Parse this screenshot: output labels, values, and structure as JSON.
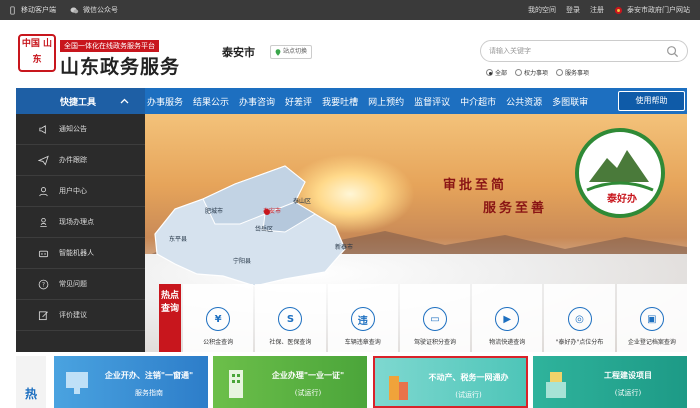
{
  "topbar": {
    "left": [
      "移动客户端",
      "微信公众号"
    ],
    "right": [
      "我的空间",
      "登录",
      "注册",
      "泰安市政府门户网站"
    ]
  },
  "header": {
    "logo_text": "中国 山东",
    "slogan": "全国一体化在线政务服务平台",
    "site_name": "山东政务服务",
    "city": "泰安市",
    "switch_label": "站点切换",
    "search_placeholder": "请输入关键字",
    "filters": [
      "全部",
      "权力事项",
      "服务事项"
    ],
    "filter_selected": "全部"
  },
  "nav": {
    "tool_label": "快捷工具",
    "items": [
      "办事服务",
      "结果公示",
      "办事咨询",
      "好差评",
      "我要吐槽",
      "网上预约",
      "监督评议",
      "中介超市",
      "公共资源",
      "多图联审"
    ],
    "help": "使用帮助"
  },
  "sidebar": {
    "items": [
      {
        "label": "通知公告",
        "icon": "megaphone-icon"
      },
      {
        "label": "办件跟踪",
        "icon": "paper-plane-icon"
      },
      {
        "label": "用户中心",
        "icon": "user-icon"
      },
      {
        "label": "现场办理点",
        "icon": "person-pin-icon"
      },
      {
        "label": "智能机器人",
        "icon": "robot-icon"
      },
      {
        "label": "常见问题",
        "icon": "question-icon"
      },
      {
        "label": "评价建议",
        "icon": "edit-icon"
      }
    ]
  },
  "banner": {
    "slogan_line1": "审批至简",
    "slogan_line2": "服务至善",
    "emblem_text": "泰好办",
    "map_labels": [
      "肥城市",
      "泰安市",
      "泰山区",
      "岱岳区",
      "东平县",
      "宁阳县",
      "新泰市"
    ]
  },
  "hot_label": "热点查询",
  "hot_tiles": [
    {
      "label": "公积金查询",
      "glyph": "¥",
      "icon": "yuan-icon"
    },
    {
      "label": "社保、医保查询",
      "glyph": "S",
      "icon": "shield-icon"
    },
    {
      "label": "车辆违章查询",
      "glyph": "违",
      "icon": "violation-icon"
    },
    {
      "label": "驾驶证积分查询",
      "glyph": "▭",
      "icon": "license-icon"
    },
    {
      "label": "物流快递查询",
      "glyph": "▶",
      "icon": "truck-icon"
    },
    {
      "label": "\"泰好办\"点位分布",
      "glyph": "◎",
      "icon": "location-icon"
    },
    {
      "label": "企业登记档案查询",
      "glyph": "▣",
      "icon": "archive-icon"
    }
  ],
  "bottom": {
    "hot_char": "热",
    "cards": [
      {
        "line1": "企业开办、注销\"一窗通\"",
        "line2": "服务指南"
      },
      {
        "line1": "企业办理\"一业一证\"",
        "line2": "(试运行)"
      },
      {
        "line1": "不动产、税务一网通办",
        "line2": "(试运行)"
      },
      {
        "line1": "工程建设项目",
        "line2": "(试运行)"
      }
    ]
  },
  "colors": {
    "brand_red": "#c8161d",
    "nav_blue": "#1d6fc0",
    "sidebar_dark": "#2b2b2b"
  }
}
